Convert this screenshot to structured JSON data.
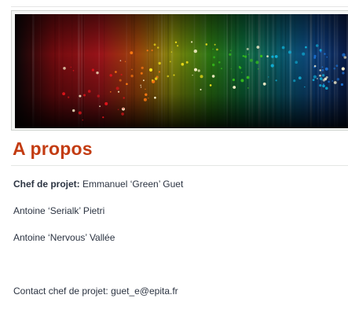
{
  "banner": {
    "image": "space-glitter-spectrum",
    "colors": [
      "#e0141b",
      "#ff7a12",
      "#f5e21a",
      "#37c21c",
      "#0fb0d8",
      "#1c6fd1"
    ]
  },
  "content": {
    "title": "A propos",
    "lead_label": "Chef de projet:",
    "lead_name": "Emmanuel ‘Green’ Guet",
    "member_2": "Antoine ‘Serialk’ Pietri",
    "member_3": "Antoine ‘Nervous’ Vallée",
    "contact_label": "Contact chef de projet:",
    "contact_email": "guet_e@epita.fr"
  }
}
